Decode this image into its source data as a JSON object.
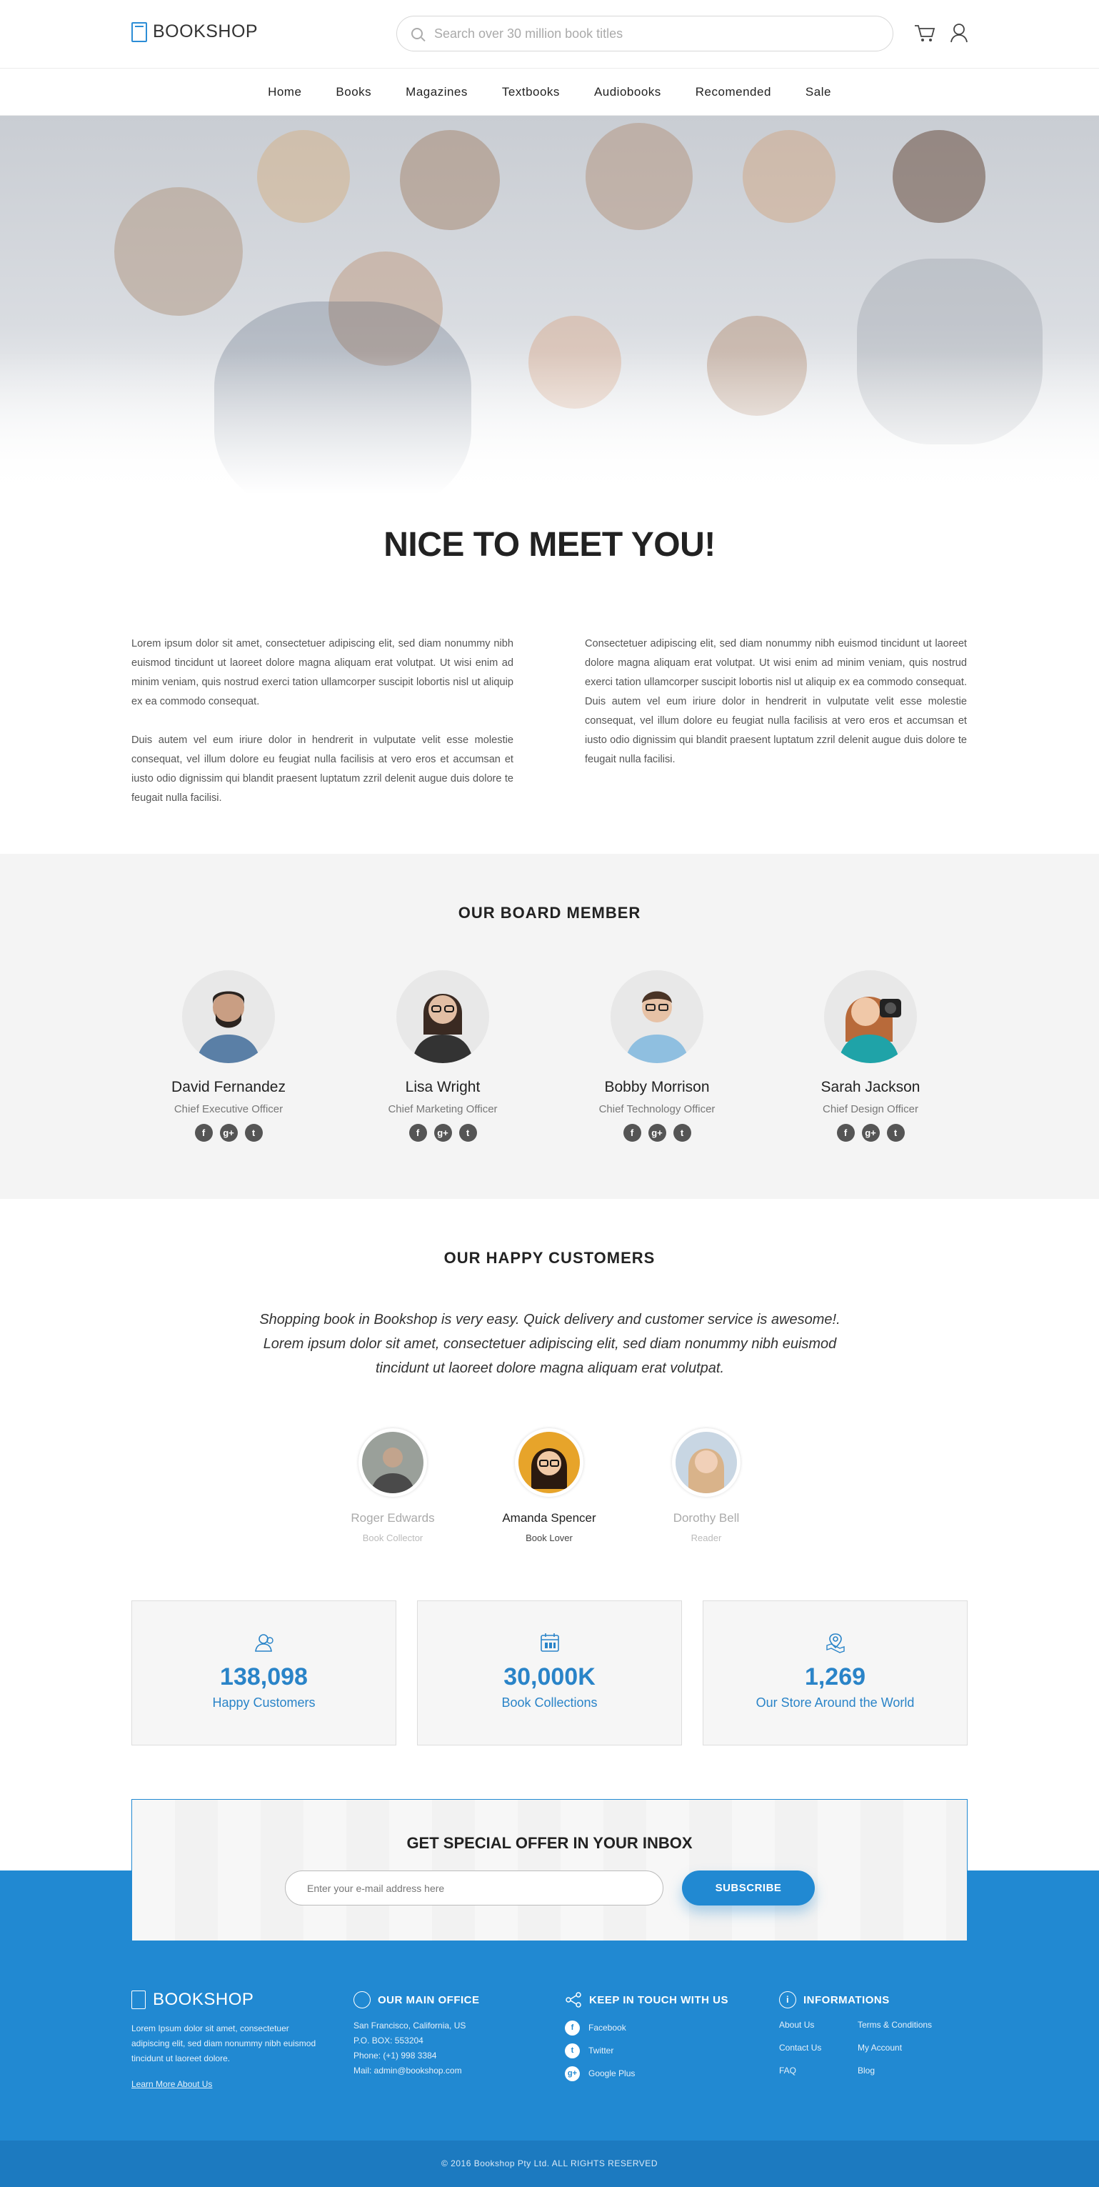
{
  "header": {
    "logo": "BOOKSHOP",
    "search_placeholder": "Search over 30 million book titles",
    "nav": [
      "Home",
      "Books",
      "Magazines",
      "Textbooks",
      "Audiobooks",
      "Recomended",
      "Sale"
    ]
  },
  "about": {
    "title": "NICE TO MEET YOU!",
    "col1_p1": "Lorem ipsum dolor sit amet, consectetuer adipiscing elit, sed diam nonummy nibh euismod tincidunt ut laoreet dolore magna aliquam erat volutpat. Ut wisi enim ad minim veniam, quis nostrud exerci tation ullamcorper suscipit lobortis nisl ut aliquip ex ea commodo consequat.",
    "col1_p2": "Duis autem vel eum iriure dolor in hendrerit in vulputate velit esse molestie consequat, vel illum dolore eu feugiat nulla facilisis at vero eros et accumsan et iusto odio dignissim qui blandit praesent luptatum zzril delenit augue duis dolore te feugait nulla facilisi.",
    "col2": "Consectetuer adipiscing elit, sed diam nonummy nibh euismod tincidunt ut laoreet dolore magna aliquam erat volutpat. Ut wisi enim ad minim veniam, quis nostrud exerci tation ullamcorper suscipit lobortis nisl ut aliquip ex ea commodo consequat. Duis autem vel eum iriure dolor in hendrerit in vulputate velit esse molestie consequat, vel illum dolore eu feugiat nulla facilisis at vero eros et accumsan et iusto odio dignissim qui blandit praesent luptatum zzril delenit augue duis dolore te feugait nulla facilisi."
  },
  "board": {
    "title": "OUR BOARD MEMBER",
    "members": [
      {
        "name": "David Fernandez",
        "role": "Chief Executive Officer"
      },
      {
        "name": "Lisa Wright",
        "role": "Chief Marketing Officer"
      },
      {
        "name": "Bobby Morrison",
        "role": "Chief Technology Officer"
      },
      {
        "name": "Sarah Jackson",
        "role": "Chief Design Officer"
      }
    ],
    "social_icons": [
      "facebook-icon",
      "google-plus-icon",
      "twitter-icon"
    ]
  },
  "customers": {
    "title": "OUR HAPPY CUSTOMERS",
    "quote": "Shopping book in Bookshop is very easy. Quick delivery and customer service is awesome!. Lorem ipsum dolor sit amet, consectetuer adipiscing elit, sed diam nonummy nibh euismod tincidunt ut laoreet dolore magna aliquam erat volutpat.",
    "list": [
      {
        "name": "Roger Edwards",
        "role": "Book Collector"
      },
      {
        "name": "Amanda Spencer",
        "role": "Book Lover"
      },
      {
        "name": "Dorothy Bell",
        "role": "Reader"
      }
    ]
  },
  "stats": [
    {
      "value": "138,098",
      "label": "Happy Customers",
      "icon": "users-icon"
    },
    {
      "value": "30,000K",
      "label": "Book Collections",
      "icon": "books-icon"
    },
    {
      "value": "1,269",
      "label": "Our Store Around the World",
      "icon": "map-pin-icon"
    }
  ],
  "newsletter": {
    "title": "GET SPECIAL OFFER IN YOUR INBOX",
    "placeholder": "Enter your e-mail address here",
    "button": "SUBSCRIBE"
  },
  "footer": {
    "logo": "BOOKSHOP",
    "about_text": "Lorem Ipsum dolor sit amet, consectetuer adipiscing elit, sed diam nonummy nibh euismod tincidunt ut laoreet dolore.",
    "about_link": "Learn More About Us",
    "office_title": "OUR MAIN OFFICE",
    "office_lines": [
      "San Francisco, California, US",
      "P.O. BOX: 553204",
      "Phone: (+1) 998 3384",
      "Mail: admin@bookshop.com"
    ],
    "touch_title": "KEEP IN TOUCH WITH US",
    "touch_links": [
      "Facebook",
      "Twitter",
      "Google Plus"
    ],
    "info_title": "INFORMATIONS",
    "info_links": [
      "About Us",
      "Terms & Conditions",
      "Contact Us",
      "My Account",
      "FAQ",
      "Blog"
    ],
    "copyright": "© 2016 Bookshop Pty Ltd. ALL RIGHTS RESERVED"
  },
  "colors": {
    "accent": "#2189d2",
    "stat_text": "#2a84c8"
  }
}
